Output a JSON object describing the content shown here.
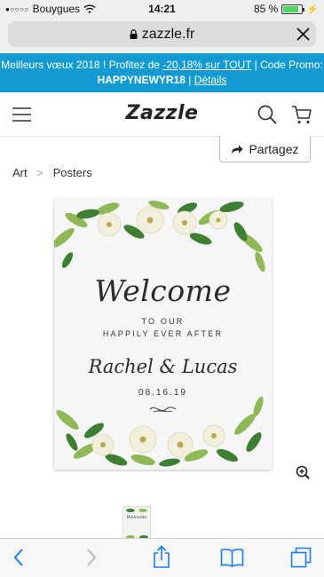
{
  "status_bar": {
    "signal": "●○○○○",
    "carrier": "Bouygues",
    "time": "14:21",
    "battery": "85 %",
    "battery_level": 0.85
  },
  "browser": {
    "url": "zazzle.fr"
  },
  "promo": {
    "prefix": "Meilleurs vœux 2018 ! Profitez de ",
    "discount_link": "-20,18% sur TOUT",
    "middle": " | Code Promo: ",
    "code": "HAPPYNEWYR18",
    "separator": " | ",
    "details_link": "Détails"
  },
  "header": {
    "logo": "Zazzle"
  },
  "share": {
    "label": "Partagez"
  },
  "breadcrumb": {
    "items": [
      "Art",
      "Posters"
    ],
    "separator": ">"
  },
  "poster": {
    "title": "Welcome",
    "line1": "TO OUR",
    "line2": "HAPPILY EVER AFTER",
    "names": "Rachel & Lucas",
    "date": "08.16.19"
  },
  "thumbnail": {
    "text": "Welcome"
  },
  "colors": {
    "promo_bg": "#139bd1",
    "ios_blue": "#1a7cf5",
    "leaf_dark": "#3f7f34",
    "leaf_light": "#8fb957",
    "flower": "#f3efdd"
  }
}
